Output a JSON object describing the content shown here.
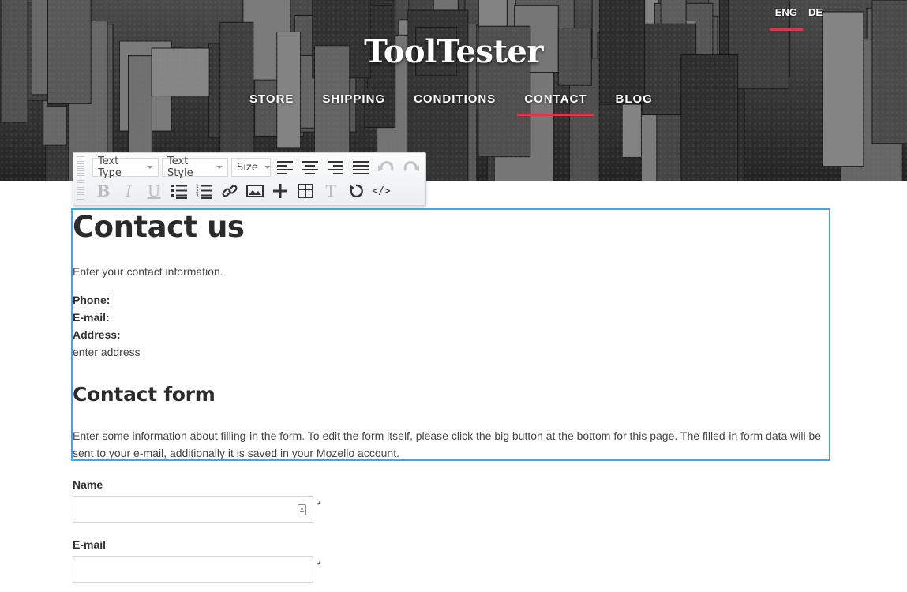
{
  "site": {
    "title": "ToolTester",
    "languages": [
      {
        "label": "ENG",
        "active": true
      },
      {
        "label": "DE",
        "active": false
      }
    ],
    "nav": [
      {
        "label": "STORE",
        "active": false
      },
      {
        "label": "SHIPPING",
        "active": false
      },
      {
        "label": "CONDITIONS",
        "active": false
      },
      {
        "label": "CONTACT",
        "active": true
      },
      {
        "label": "BLOG",
        "active": false
      }
    ]
  },
  "toolbar": {
    "text_type": "Text Type",
    "text_style": "Text Style",
    "size": "Size",
    "bold_glyph": "B",
    "italic_glyph": "I",
    "underline_glyph": "U",
    "clear_format_glyph": "T",
    "source_glyph": "</>"
  },
  "content": {
    "heading": "Contact us",
    "intro": "Enter your contact information.",
    "phone_label": "Phone:",
    "email_label": "E-mail:",
    "address_label": "Address:",
    "address_value": "enter address",
    "form_heading": "Contact form",
    "form_description": "Enter some information about filling-in the form. To edit the form itself, please click the big button at the bottom for this page. The filled-in form data will be sent to your e-mail, additionally it is saved in your Mozello account."
  },
  "form": {
    "name_label": "Name",
    "email_label": "E-mail",
    "required_mark": "*"
  },
  "colors": {
    "accent": "#d9394f",
    "selection_border": "#4aa3df"
  }
}
